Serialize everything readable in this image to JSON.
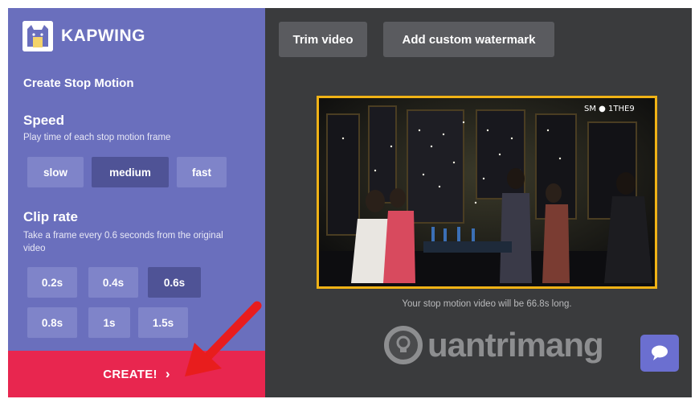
{
  "brand": {
    "name": "KAPWING",
    "logo_icon": "kapwing-cat-logo-icon"
  },
  "sidebar": {
    "title": "Create Stop Motion",
    "speed": {
      "heading": "Speed",
      "description": "Play time of each stop motion frame",
      "options": [
        "slow",
        "medium",
        "fast"
      ],
      "selected": "medium"
    },
    "clip_rate": {
      "heading": "Clip rate",
      "description": "Take a frame every 0.6 seconds from the original video",
      "options": [
        "0.2s",
        "0.4s",
        "0.6s",
        "0.8s",
        "1s",
        "1.5s"
      ],
      "selected": "0.6s"
    },
    "create_label": "CREATE!",
    "create_chevron": "›"
  },
  "toolbar": {
    "trim_label": "Trim video",
    "watermark_label": "Add custom watermark"
  },
  "video": {
    "corner_text": "SM  ● 1THE9",
    "message": "Your stop motion video will be 66.8s long."
  },
  "overlay": {
    "watermark_text": "uantrimang",
    "chat_icon": "chat-bubble-icon",
    "annotation_icon": "red-arrow-icon"
  },
  "colors": {
    "sidebar": "#6a6fbd",
    "active_option": "#4f5396",
    "create": "#e8264f",
    "video_border": "#f0b216",
    "main_bg": "#3a3b3d"
  }
}
